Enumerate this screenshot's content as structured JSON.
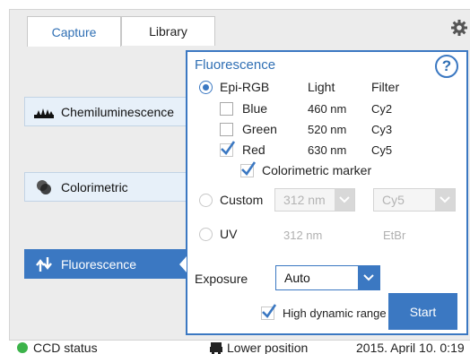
{
  "tabs": [
    {
      "label": "Capture"
    },
    {
      "label": "Library"
    }
  ],
  "modes": [
    {
      "label": "Chemiluminescence",
      "icon": "chemiluminescence-icon"
    },
    {
      "label": "Colorimetric",
      "icon": "colorimetric-icon"
    },
    {
      "label": "Fluorescence",
      "icon": "fluorescence-icon",
      "active": true
    }
  ],
  "panel": {
    "title": "Fluorescence",
    "help_label": "?",
    "epi": {
      "label": "Epi-RGB",
      "col_light": "Light",
      "col_filter": "Filter",
      "selected": true
    },
    "channels": [
      {
        "label": "Blue",
        "light": "460 nm",
        "filter": "Cy2",
        "checked": false
      },
      {
        "label": "Green",
        "light": "520 nm",
        "filter": "Cy3",
        "checked": false
      },
      {
        "label": "Red",
        "light": "630 nm",
        "filter": "Cy5",
        "checked": true
      }
    ],
    "colorimetric_marker": {
      "label": "Colorimetric marker",
      "checked": true
    },
    "custom": {
      "label": "Custom",
      "light_value": "312 nm",
      "filter_value": "Cy5",
      "selected": false
    },
    "uv": {
      "label": "UV",
      "light": "312 nm",
      "filter": "EtBr",
      "selected": false
    },
    "exposure": {
      "label": "Exposure",
      "value": "Auto"
    },
    "hdr": {
      "label": "High dynamic range",
      "checked": true
    },
    "start_label": "Start"
  },
  "status": {
    "ccd": "CCD status",
    "position": "Lower position",
    "datetime": "2015. April 10. 0:19"
  },
  "colors": {
    "accent": "#3b78c2",
    "status_ok": "#3cb34a"
  }
}
